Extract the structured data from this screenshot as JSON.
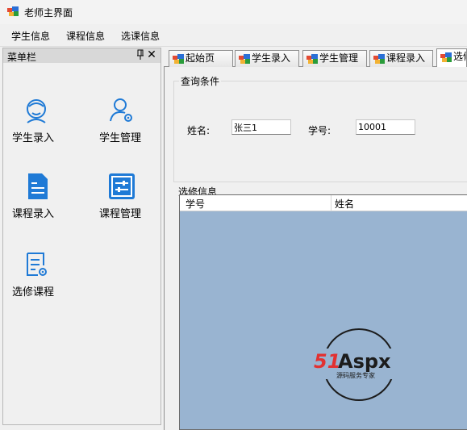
{
  "window": {
    "title": "老师主界面"
  },
  "menu": {
    "items": [
      "学生信息",
      "课程信息",
      "选课信息"
    ]
  },
  "dock": {
    "title": "菜单栏",
    "buttons": [
      {
        "label": "学生录入",
        "icon": "student-entry-icon"
      },
      {
        "label": "学生管理",
        "icon": "student-manage-icon"
      },
      {
        "label": "课程录入",
        "icon": "course-entry-icon"
      },
      {
        "label": "课程管理",
        "icon": "course-manage-icon"
      },
      {
        "label": "选修课程",
        "icon": "elective-course-icon"
      }
    ]
  },
  "tabs": [
    {
      "label": "起始页"
    },
    {
      "label": "学生录入"
    },
    {
      "label": "学生管理"
    },
    {
      "label": "课程录入"
    },
    {
      "label": "选修"
    }
  ],
  "query": {
    "legend": "查询条件",
    "name_label": "姓名:",
    "name_value": "张三1",
    "id_label": "学号:",
    "id_value": "10001"
  },
  "selection": {
    "label": "选修信息",
    "columns": [
      "学号",
      "姓名"
    ]
  },
  "watermark": {
    "brand": "51Aspx",
    "tagline": "源码服务专家"
  },
  "colors": {
    "grid_bg": "#99b4d1",
    "icon_blue": "#1f7ad6",
    "tab_icon_red": "#e34a33",
    "tab_icon_blue": "#2a6fd6"
  }
}
